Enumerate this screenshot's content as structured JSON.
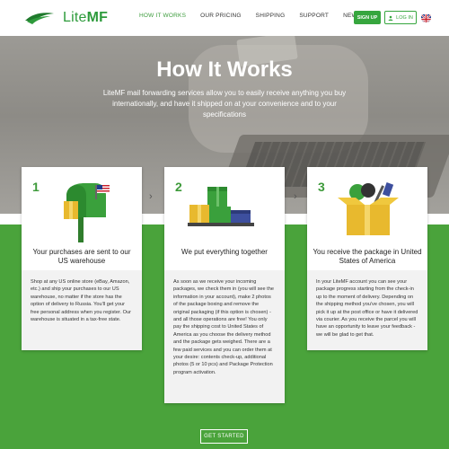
{
  "brand": {
    "name_light": "Lite",
    "name_bold": "MF"
  },
  "nav": [
    {
      "label": "HOW IT WORKS",
      "active": true
    },
    {
      "label": "OUR PRICING",
      "active": false
    },
    {
      "label": "SHIPPING",
      "active": false
    },
    {
      "label": "SUPPORT",
      "active": false
    },
    {
      "label": "NEWS",
      "active": false
    }
  ],
  "auth": {
    "signup_label": "SIGN UP",
    "login_label": "LOG IN"
  },
  "hero": {
    "title": "How It Works",
    "subtitle": "LiteMF mail forwarding services allow you to easily receive anything you buy internationally, and have it shipped on at your convenience and to your specifications"
  },
  "steps": [
    {
      "number": "1",
      "title": "Your purchases are sent to our US warehouse",
      "body": "Shop at any US online store (eBay, Amazon, etc.) and ship your purchases to our US warehouse, no matter if the store has the option of delivery to Russia. You'll get your free personal address when you register. Our warehouse is situated in a tax-free state."
    },
    {
      "number": "2",
      "title": "We put everything together",
      "body": "As soon as we receive your incoming packages, we check them in (you will see the information in your account), make 2 photos of the package boxing and remove the original packaging (if this option is chosen) - and all those operations are free! You only pay the shipping cost to United States of America as you choose the delivery method and the package gets weighed. There are a few paid services and you can order them at your desire: contents check-up, additional photos (5 or 10 pcs) and Package Protection program activation."
    },
    {
      "number": "3",
      "title": "You receive the package in United States of America",
      "body": "In your LiteMF account you can see your package progress starting from the check-in up to the moment of delivery. Depending on the shipping method you've chosen, you will pick it up at the post office or have it delivered via courier. As you receive the parcel you will have an opportunity to leave your feedback - we will be glad to get that."
    }
  ],
  "cta": {
    "label": "GET STARTED"
  },
  "colors": {
    "brand_green": "#36a63e",
    "band_green": "#4aa33b"
  }
}
